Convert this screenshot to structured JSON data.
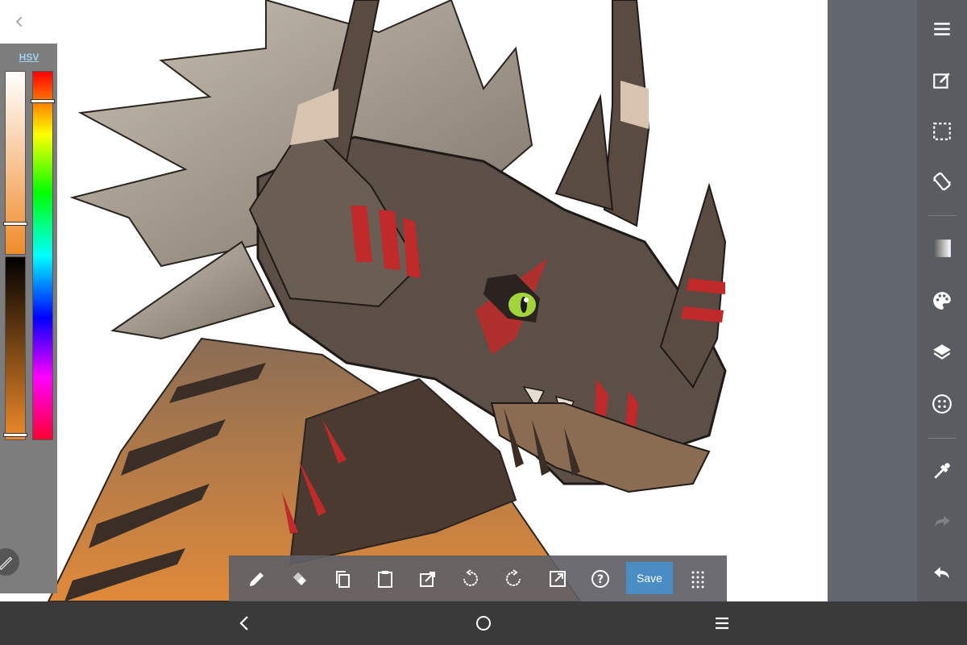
{
  "color_panel": {
    "mode_label": "HSV",
    "current_color": "#f08b2a",
    "hue_level": 0.08,
    "saturation_level": 0.83,
    "value_level": 0.97
  },
  "bottom_toolbar": {
    "save_label": "Save",
    "icons": [
      "pencil-icon",
      "eraser-icon",
      "copy-icon",
      "paste-icon",
      "import-icon",
      "undo-icon",
      "redo-icon",
      "export-icon",
      "help-icon",
      "grid-icon"
    ]
  },
  "right_toolbar": {
    "icons": [
      "menu-icon",
      "edit-icon",
      "selection-icon",
      "rotate-icon",
      "gradient-icon",
      "palette-icon",
      "layers-icon",
      "dots-icon",
      "eyedropper-icon",
      "redo-icon",
      "undo-icon"
    ]
  },
  "nav_bar": {
    "icons": [
      "back-icon",
      "home-icon",
      "recents-icon"
    ]
  },
  "colors": {
    "accent": "#4a8cc4",
    "toolbar_bg": "#595c61",
    "panel_bg": "#7d7d7d"
  }
}
